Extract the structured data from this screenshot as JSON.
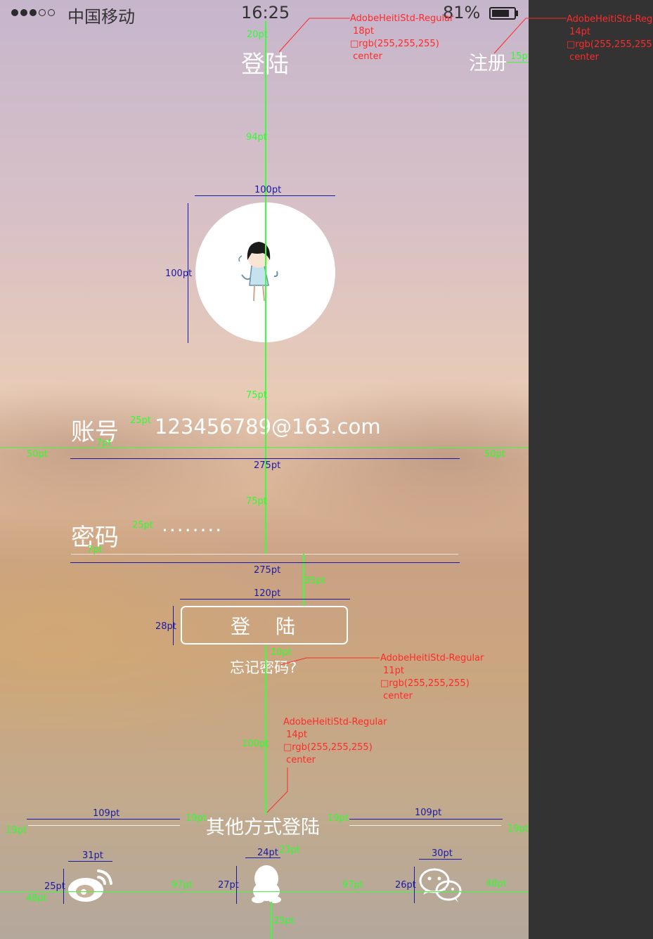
{
  "status_bar": {
    "carrier": "中国移动",
    "time": "16:25",
    "battery_text": "81%",
    "battery_level": 0.81,
    "signal_full": 3,
    "signal_total": 5
  },
  "nav": {
    "title": "登陆",
    "register": "注册"
  },
  "account": {
    "label": "账号",
    "value": "123456789@163.com"
  },
  "password": {
    "label": "密码",
    "value": "········"
  },
  "login_button": "登　陆",
  "forgot_password": "忘记密码?",
  "other_login": {
    "title": "其他方式登陆",
    "options": [
      "weibo-icon",
      "qq-icon",
      "wechat-icon"
    ]
  },
  "spec_notes": {
    "title_note": {
      "font": "AdobeHeitiStd-Regular",
      "size": "18pt",
      "color": "rgb(255,255,255)",
      "align": "center"
    },
    "register_note": {
      "font": "AdobeHeitiStd-Regu",
      "size": "14pt",
      "color": "rgb(255,255,255)",
      "align": "center"
    },
    "forgot_note": {
      "font": "AdobeHeitiStd-Regular",
      "size": "11pt",
      "color": "rgb(255,255,255)",
      "align": "center"
    },
    "other_note": {
      "font": "AdobeHeitiStd-Regular",
      "size": "14pt",
      "color": "rgb(255,255,255)",
      "align": "center"
    }
  },
  "measurements": {
    "title_top": "20pt",
    "register_right": "15pt",
    "title_to_avatar": "94pt",
    "avatar_width": "100pt",
    "avatar_height": "100pt",
    "avatar_to_account": "75pt",
    "account_label_gap": "25pt",
    "account_underline_gap": "7pt",
    "left_margin": "50pt",
    "right_margin": "50pt",
    "field_width": "275pt",
    "account_to_password": "75pt",
    "password_label_gap": "25pt",
    "password_underline_gap": "7pt",
    "password_field_width": "275pt",
    "password_to_button": "35pt",
    "button_width": "120pt",
    "button_height": "28pt",
    "button_to_forgot": "10pt",
    "forgot_to_other": "100pt",
    "left_line": "109pt",
    "left_gap": "19pt",
    "right_gap": "19pt",
    "right_line": "109pt",
    "outer_left": "19pt",
    "outer_right": "19pt",
    "other_to_icons": "23pt",
    "weibo_width": "31pt",
    "weibo_height": "25pt",
    "weibo_left": "48pt",
    "weibo_to_qq": "97pt",
    "qq_width": "24pt",
    "qq_height": "27pt",
    "qq_to_wechat": "97pt",
    "wechat_width": "30pt",
    "wechat_height": "26pt",
    "wechat_right": "48pt",
    "icons_bottom": "25pt"
  }
}
